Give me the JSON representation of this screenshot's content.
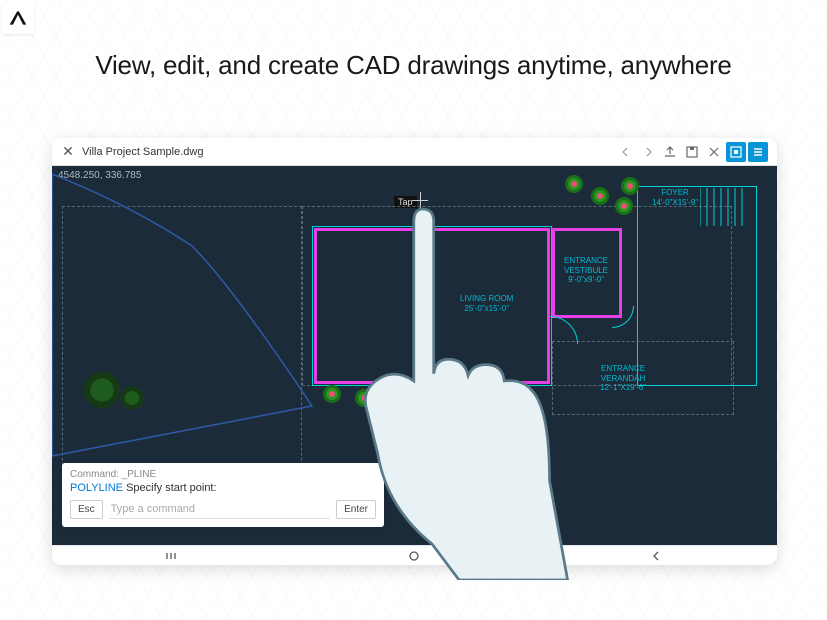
{
  "logo_letter": "A",
  "headline": "View, edit, and create CAD drawings anytime, anywhere",
  "topbar": {
    "close_glyph": "✕",
    "filename": "Villa Project Sample.dwg"
  },
  "canvas": {
    "coordinates": "4548.250, 336.785",
    "tap_label": "Tap",
    "rooms": {
      "foyer": "FOYER\n14'-0\"X15'-9\"",
      "vestibule": "ENTRANCE\nVESTIBULE\n9'-0\"x9'-0\"",
      "living": "LIVING ROOM\n25'-0\"x15'-0\"",
      "verandah": "ENTRANCE\nVERANDAH\n12'-1\"X19'-6\""
    }
  },
  "command": {
    "history_prefix": "Command:",
    "history_name": "_PLINE",
    "active_name": "POLYLINE",
    "active_prompt": "Specify start point:",
    "esc_label": "Esc",
    "input_placeholder": "Type a command",
    "enter_label": "Enter"
  }
}
